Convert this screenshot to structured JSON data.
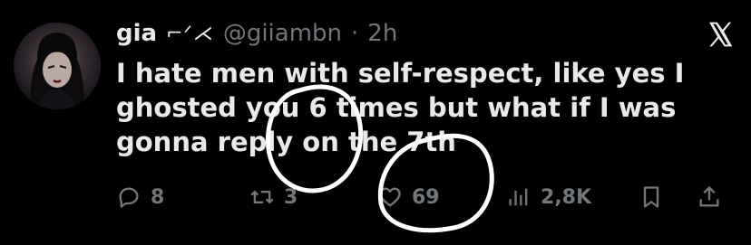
{
  "author": {
    "name": "gia",
    "name_decoration": "⌐ᐟ⋌",
    "handle": "@giiambn",
    "separator": "·",
    "time": "2h"
  },
  "tweet": {
    "text": "I hate men with self-respect, like yes I ghosted you 6 times but what if I was gonna reply on the 7th"
  },
  "actions": {
    "replies": "8",
    "reposts": "3",
    "likes": "69",
    "views": "2,8K"
  },
  "colors": {
    "background": "#000000",
    "text": "#e7e9ea",
    "muted": "#71767b",
    "annotation": "#ffffff"
  }
}
